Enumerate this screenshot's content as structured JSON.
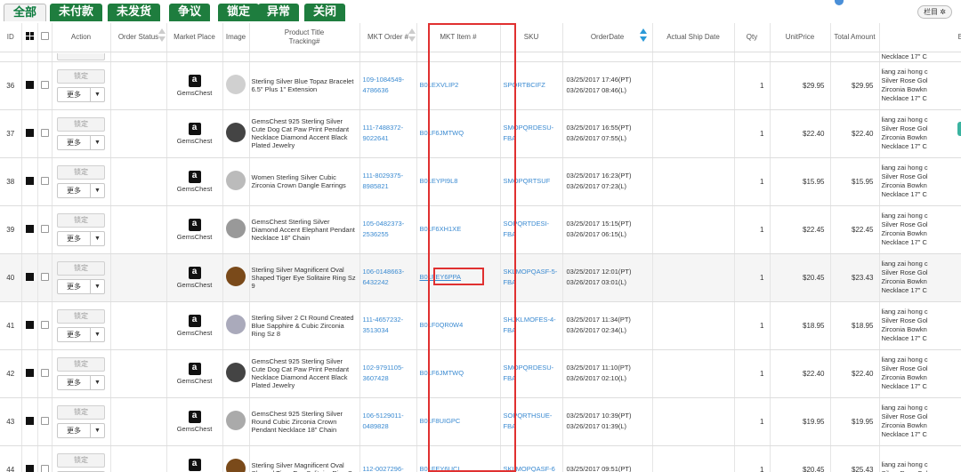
{
  "tabs": [
    "全部",
    "未付款",
    "未发货",
    "争议",
    "锁定",
    "异常",
    "关闭"
  ],
  "columns_button": "栏目 ✲",
  "headers": {
    "id": "ID",
    "action": "Action",
    "order_status": "Order Status",
    "market_place": "Market Place",
    "image": "Image",
    "product_title": "Product Title",
    "tracking": "Tracking#",
    "mkt_order": "MKT Order #",
    "mkt_item": "MKT Item #",
    "sku": "SKU",
    "order_date": "OrderDate",
    "actual_ship_date": "Actual Ship Date",
    "qty": "Qty",
    "unit_price": "UnitPrice",
    "total_amount": "Total Amount",
    "buyer": "Buyer"
  },
  "action_labels": {
    "lock": "锁定",
    "more": "更多"
  },
  "buyer_partial_top": "Necklace 17\" C",
  "rows": [
    {
      "id": "36",
      "market": "GemsChest",
      "title": "Sterling Silver Blue Topaz Bracelet 6.5\" Plus 1\" Extension",
      "order1": "109-1084549-",
      "order2": "4786636",
      "item": "B01EXVLIP2",
      "sku1": "SPQRTBCIFZ",
      "sku2": "",
      "date1": "03/25/2017 17:46(PT)",
      "date2": "03/26/2017 08:46(L)",
      "qty": "1",
      "unit": "$29.95",
      "total": "$29.95",
      "buyer": [
        "liang zai hong c",
        "Silver Rose Gol",
        "Zirconia Bowkn",
        "Necklace 17\" C"
      ],
      "img_color": "#d0d0d0"
    },
    {
      "id": "37",
      "market": "GemsChest",
      "title": "GemsChest 925 Sterling Silver Cute Dog Cat Paw Print Pendant Necklace Diamond Accent Black Plated Jewelry",
      "order1": "111-7488372-",
      "order2": "9022641",
      "item": "B01F6JMTWQ",
      "sku1": "SMOPQRDESU-",
      "sku2": "FBA",
      "date1": "03/25/2017 16:55(PT)",
      "date2": "03/26/2017 07:55(L)",
      "qty": "1",
      "unit": "$22.40",
      "total": "$22.40",
      "buyer": [
        "liang zai hong c",
        "Silver Rose Gol",
        "Zirconia Bowkn",
        "Necklace 17\" C"
      ],
      "img_color": "#444"
    },
    {
      "id": "38",
      "market": "GemsChest",
      "title": "Women Sterling Silver Cubic Zirconia Crown Dangle Earrings",
      "order1": "111-8029375-",
      "order2": "8985821",
      "item": "B01EYPI9L8",
      "sku1": "SMOPQRTSUF",
      "sku2": "",
      "date1": "03/25/2017 16:23(PT)",
      "date2": "03/26/2017 07:23(L)",
      "qty": "1",
      "unit": "$15.95",
      "total": "$15.95",
      "buyer": [
        "liang zai hong c",
        "Silver Rose Gol",
        "Zirconia Bowkn",
        "Necklace 17\" C"
      ],
      "img_color": "#bbb"
    },
    {
      "id": "39",
      "market": "GemsChest",
      "title": "GemsChest Sterling Silver Diamond Accent Elephant Pendant Necklace 18\" Chain",
      "order1": "105-0482373-",
      "order2": "2536255",
      "item": "B01F6XH1XE",
      "sku1": "SOPQRTDESI-FBA",
      "sku2": "",
      "date1": "03/25/2017 15:15(PT)",
      "date2": "03/26/2017 06:15(L)",
      "qty": "1",
      "unit": "$22.45",
      "total": "$22.45",
      "buyer": [
        "liang zai hong c",
        "Silver Rose Gol",
        "Zirconia Bowkn",
        "Necklace 17\" C"
      ],
      "img_color": "#999"
    },
    {
      "id": "40",
      "market": "GemsChest",
      "title": "Sterling Silver Magnificent Oval Shaped Tiger Eye Solitaire Ring Sz 9",
      "order1": "106-0148663-",
      "order2": "6432242",
      "item": "B01FEY6PPA",
      "sku1": "SKLMOPQASF-5-",
      "sku2": "FBA",
      "date1": "03/25/2017 12:01(PT)",
      "date2": "03/26/2017 03:01(L)",
      "qty": "1",
      "unit": "$20.45",
      "total": "$23.43",
      "buyer": [
        "liang zai hong c",
        "Silver Rose Gol",
        "Zirconia Bowkn",
        "Necklace 17\" C"
      ],
      "img_color": "#7a4a1a",
      "highlight": true
    },
    {
      "id": "41",
      "market": "GemsChest",
      "title": "Sterling Silver 2 Ct Round Created Blue Sapphire & Cubic Zirconia Ring Sz 8",
      "order1": "111-4657232-",
      "order2": "3513034",
      "item": "B01F0QR0W4",
      "sku1": "SHJKLMOFES-4-",
      "sku2": "FBA",
      "date1": "03/25/2017 11:34(PT)",
      "date2": "03/26/2017 02:34(L)",
      "qty": "1",
      "unit": "$18.95",
      "total": "$18.95",
      "buyer": [
        "liang zai hong c",
        "Silver Rose Gol",
        "Zirconia Bowkn",
        "Necklace 17\" C"
      ],
      "img_color": "#aab"
    },
    {
      "id": "42",
      "market": "GemsChest",
      "title": "GemsChest 925 Sterling Silver Cute Dog Cat Paw Print Pendant Necklace Diamond Accent Black Plated Jewelry",
      "order1": "102-9791105-",
      "order2": "3607428",
      "item": "B01F6JMTWQ",
      "sku1": "SMOPQRDESU-",
      "sku2": "FBA",
      "date1": "03/25/2017 11:10(PT)",
      "date2": "03/26/2017 02:10(L)",
      "qty": "1",
      "unit": "$22.40",
      "total": "$22.40",
      "buyer": [
        "liang zai hong c",
        "Silver Rose Gol",
        "Zirconia Bowkn",
        "Necklace 17\" C"
      ],
      "img_color": "#444"
    },
    {
      "id": "43",
      "market": "GemsChest",
      "title": "GemsChest 925 Sterling Silver Round Cubic Zirconia Crown Pendant Necklace 18\" Chain",
      "order1": "106-5129011-",
      "order2": "0489828",
      "item": "B01F8UIGPC",
      "sku1": "SOPQRTHSUE-",
      "sku2": "FBA",
      "date1": "03/25/2017 10:39(PT)",
      "date2": "03/26/2017 01:39(L)",
      "qty": "1",
      "unit": "$19.95",
      "total": "$19.95",
      "buyer": [
        "liang zai hong c",
        "Silver Rose Gol",
        "Zirconia Bowkn",
        "Necklace 17\" C"
      ],
      "img_color": "#aaa"
    },
    {
      "id": "44",
      "market": "GemsChest",
      "title": "Sterling Silver Magnificent Oval Shaped Tiger Eye Solitaire Ring Sz",
      "order1": "112-0027296-",
      "order2": "",
      "item": "B01FEY6UCI",
      "sku1": "SKLMOPQASF-6",
      "sku2": "",
      "date1": "03/25/2017 09:51(PT)",
      "date2": "",
      "qty": "1",
      "unit": "$20.45",
      "total": "$25.43",
      "buyer": [
        "liang zai hong c",
        "Silver Rose Gol"
      ],
      "img_color": "#7a4a1a"
    }
  ]
}
